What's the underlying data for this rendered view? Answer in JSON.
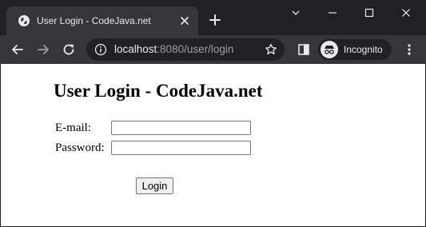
{
  "browser": {
    "tab": {
      "title": "User Login - CodeJava.net"
    },
    "address_bar": {
      "host": "localhost",
      "path": ":8080/user/login"
    },
    "profile": {
      "label": "Incognito"
    },
    "colors": {
      "frame": "#202124",
      "toolbar": "#35363a",
      "text": "#e8eaed",
      "muted": "#9aa0a6"
    }
  },
  "page": {
    "heading": "User Login - CodeJava.net",
    "form": {
      "email_label": "E-mail:",
      "email_value": "",
      "password_label": "Password:",
      "password_value": "",
      "submit_label": "Login"
    }
  }
}
